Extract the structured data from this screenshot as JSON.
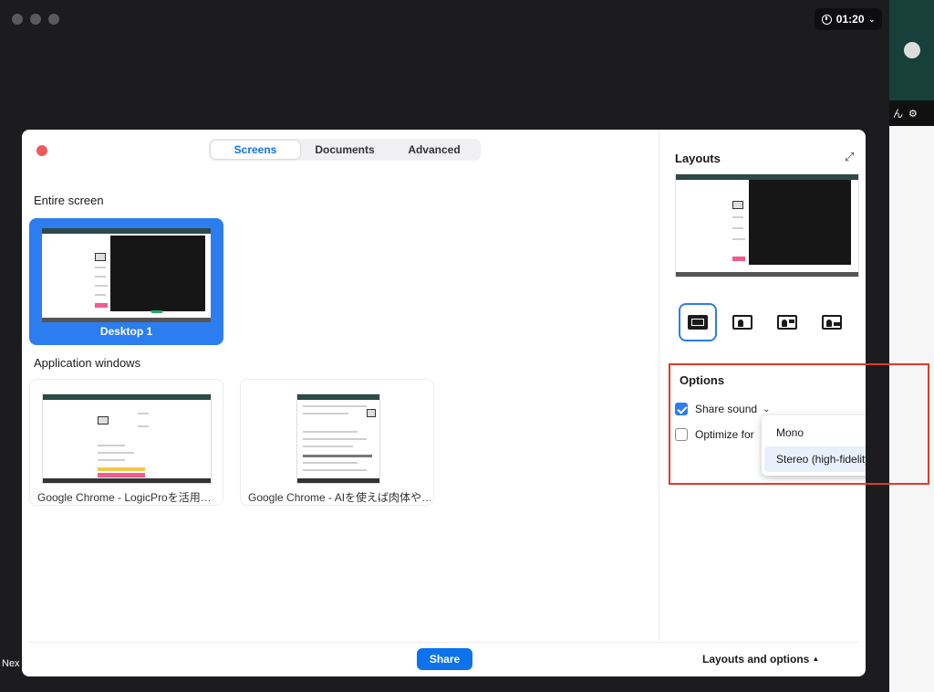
{
  "meeting": {
    "timer": "01:20",
    "next_label": "Nex",
    "participant_label": "ん"
  },
  "tabs": [
    {
      "label": "Screens",
      "active": true
    },
    {
      "label": "Documents",
      "active": false
    },
    {
      "label": "Advanced",
      "active": false
    }
  ],
  "sections": {
    "entire_screen": "Entire screen",
    "application_windows": "Application windows"
  },
  "screens": [
    {
      "caption": "Desktop 1",
      "selected": true
    }
  ],
  "app_windows": [
    {
      "caption": "Google Chrome - LogicProを活用…"
    },
    {
      "caption": "Google Chrome - AIを使えば肉体や…"
    }
  ],
  "layouts": {
    "title": "Layouts",
    "expand_icon": "expand-icon",
    "buttons": [
      {
        "name": "screen-only",
        "selected": true
      },
      {
        "name": "picture-in-picture",
        "selected": false
      },
      {
        "name": "presenter-top",
        "selected": false
      },
      {
        "name": "side-by-side",
        "selected": false
      }
    ]
  },
  "options": {
    "title": "Options",
    "share_sound": {
      "label": "Share sound",
      "checked": true
    },
    "optimize": {
      "label": "Optimize for",
      "checked": false
    }
  },
  "sound_menu": {
    "items": [
      {
        "label": "Mono",
        "selected": false
      },
      {
        "label": "Stereo (high-fidelity)",
        "selected": true
      }
    ],
    "check_glyph": "✓"
  },
  "footer": {
    "share_label": "Share",
    "layouts_options_label": "Layouts and options",
    "layouts_options_caret": "▲"
  },
  "colors": {
    "accent": "#0e72ed",
    "selection": "#2b7df0",
    "highlight_box": "#e23a2a",
    "close": "#ed5b5b"
  }
}
